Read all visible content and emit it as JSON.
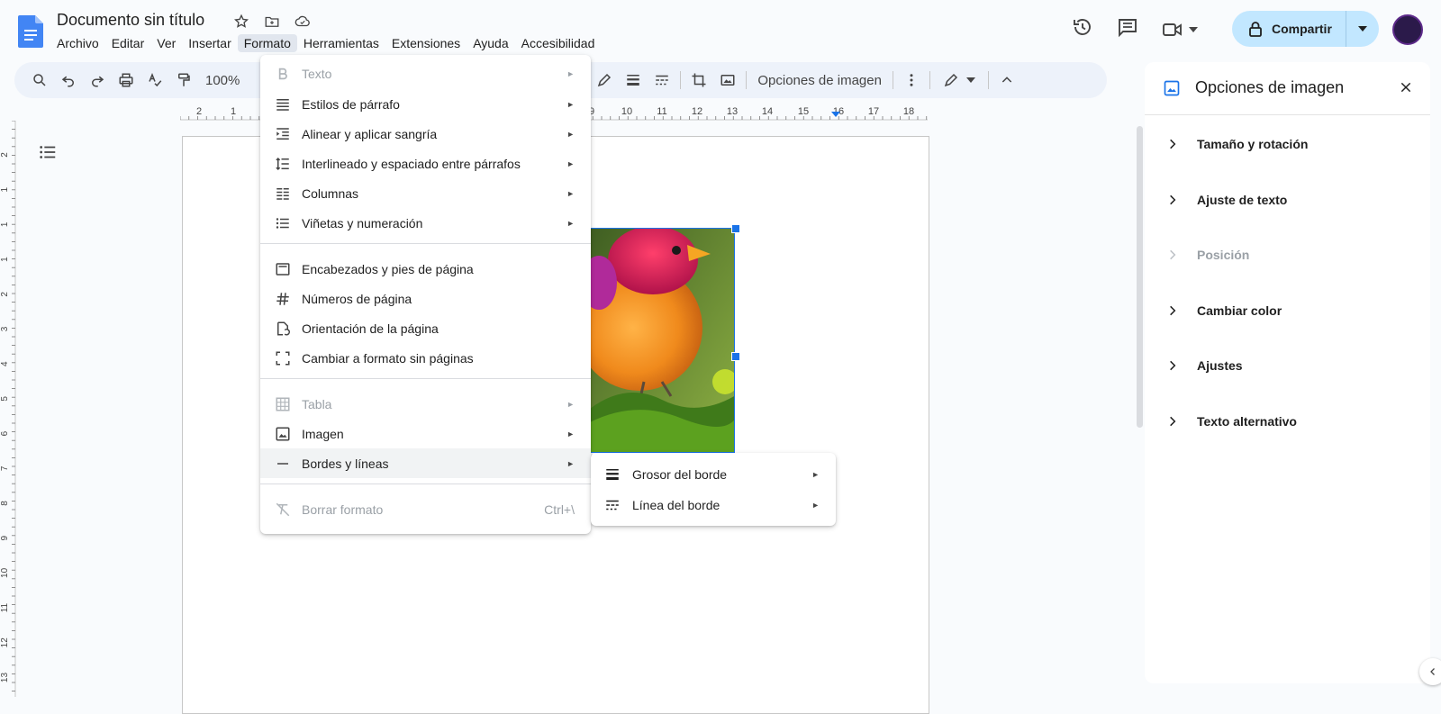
{
  "app": {
    "doc_title": "Documento sin título",
    "menus": [
      "Archivo",
      "Editar",
      "Ver",
      "Insertar",
      "Formato",
      "Herramientas",
      "Extensiones",
      "Ayuda",
      "Accesibilidad"
    ],
    "active_menu": "Formato"
  },
  "header": {
    "share_label": "Compartir"
  },
  "toolbar": {
    "zoom": "100%",
    "image_options_label": "Opciones de imagen"
  },
  "ruler": {
    "h_ticks": [
      "2",
      "1",
      "9",
      "10",
      "11",
      "12",
      "13",
      "14",
      "15",
      "16",
      "17",
      "18"
    ],
    "v_ticks": [
      "2",
      "1",
      "1",
      "1",
      "2",
      "3",
      "4",
      "5",
      "6",
      "7",
      "8",
      "9",
      "10",
      "11",
      "12",
      "13"
    ]
  },
  "format_menu": {
    "items": [
      {
        "label": "Texto",
        "icon": "bold-icon",
        "submenu": true,
        "disabled": true
      },
      {
        "label": "Estilos de párrafo",
        "icon": "paragraph-styles-icon",
        "submenu": true
      },
      {
        "label": "Alinear y aplicar sangría",
        "icon": "indent-icon",
        "submenu": true
      },
      {
        "label": "Interlineado y espaciado entre párrafos",
        "icon": "line-spacing-icon",
        "submenu": true
      },
      {
        "label": "Columnas",
        "icon": "columns-icon",
        "submenu": true
      },
      {
        "label": "Viñetas y numeración",
        "icon": "bulleted-list-icon",
        "submenu": true
      },
      {
        "label": "Encabezados y pies de página",
        "icon": "header-footer-icon"
      },
      {
        "label": "Números de página",
        "icon": "hash-icon"
      },
      {
        "label": "Orientación de la página",
        "icon": "page-orientation-icon"
      },
      {
        "label": "Cambiar a formato sin páginas",
        "icon": "pageless-icon"
      },
      {
        "label": "Tabla",
        "icon": "table-icon",
        "submenu": true,
        "disabled": true
      },
      {
        "label": "Imagen",
        "icon": "image-icon",
        "submenu": true
      },
      {
        "label": "Bordes y líneas",
        "icon": "horizontal-line-icon",
        "submenu": true,
        "highlighted": true
      },
      {
        "label": "Borrar formato",
        "icon": "clear-formatting-icon",
        "shortcut": "Ctrl+\\",
        "disabled": true
      }
    ]
  },
  "borders_submenu": {
    "items": [
      {
        "label": "Grosor del borde",
        "icon": "border-weight-icon"
      },
      {
        "label": "Línea del borde",
        "icon": "border-dash-icon"
      }
    ]
  },
  "side_panel": {
    "title": "Opciones de imagen",
    "sections": [
      {
        "label": "Tamaño y rotación",
        "disabled": false
      },
      {
        "label": "Ajuste de texto",
        "disabled": false
      },
      {
        "label": "Posición",
        "disabled": true
      },
      {
        "label": "Cambiar color",
        "disabled": false
      },
      {
        "label": "Ajustes",
        "disabled": false
      },
      {
        "label": "Texto alternativo",
        "disabled": false
      }
    ]
  },
  "colors": {
    "accent": "#1a73e8",
    "share_bg": "#c2e7ff",
    "toolbar_bg": "#edf2fa",
    "menu_highlight": "#f1f3f4"
  }
}
